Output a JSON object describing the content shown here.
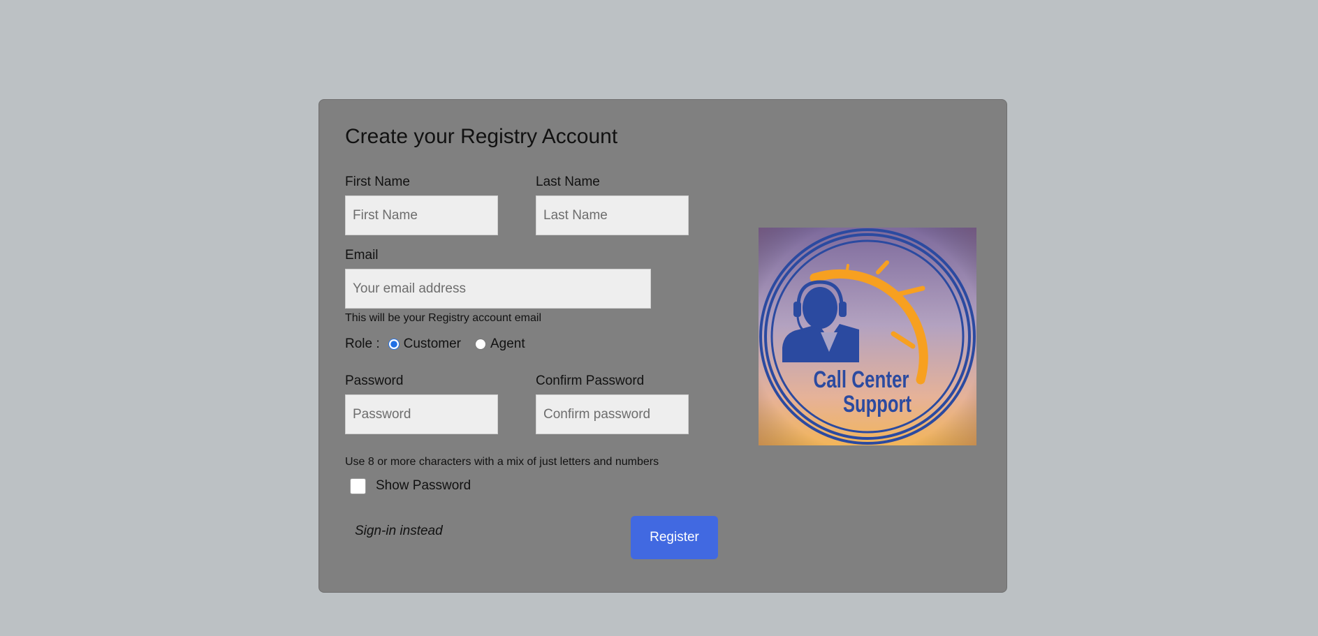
{
  "form": {
    "title": "Create your Registry Account",
    "first_name": {
      "label": "First Name",
      "placeholder": "First Name",
      "value": ""
    },
    "last_name": {
      "label": "Last Name",
      "placeholder": "Last Name",
      "value": ""
    },
    "email": {
      "label": "Email",
      "placeholder": "Your email address",
      "value": "",
      "hint": "This will be your Registry account email"
    },
    "role": {
      "label": "Role :",
      "options": [
        {
          "label": "Customer",
          "selected": true
        },
        {
          "label": "Agent",
          "selected": false
        }
      ]
    },
    "password": {
      "label": "Password",
      "placeholder": "Password",
      "value": ""
    },
    "confirm_password": {
      "label": "Confirm Password",
      "placeholder": "Confirm password",
      "value": ""
    },
    "password_hint": "Use 8 or more characters with a mix of just letters and numbers",
    "show_password": {
      "label": "Show Password",
      "checked": false
    },
    "signin_link": "Sign-in instead",
    "register_button": "Register"
  },
  "logo": {
    "icon": "call-center-agent-icon",
    "line1": "Call Center",
    "line2": "Support",
    "colors": {
      "ring": "#2b4aa0",
      "accent": "#f7a020"
    }
  },
  "colors": {
    "page_bg": "#bcc1c4",
    "card_bg": "#808080",
    "input_bg": "#eeeeee",
    "button_bg": "#4169e1",
    "button_text": "#ffffff"
  }
}
